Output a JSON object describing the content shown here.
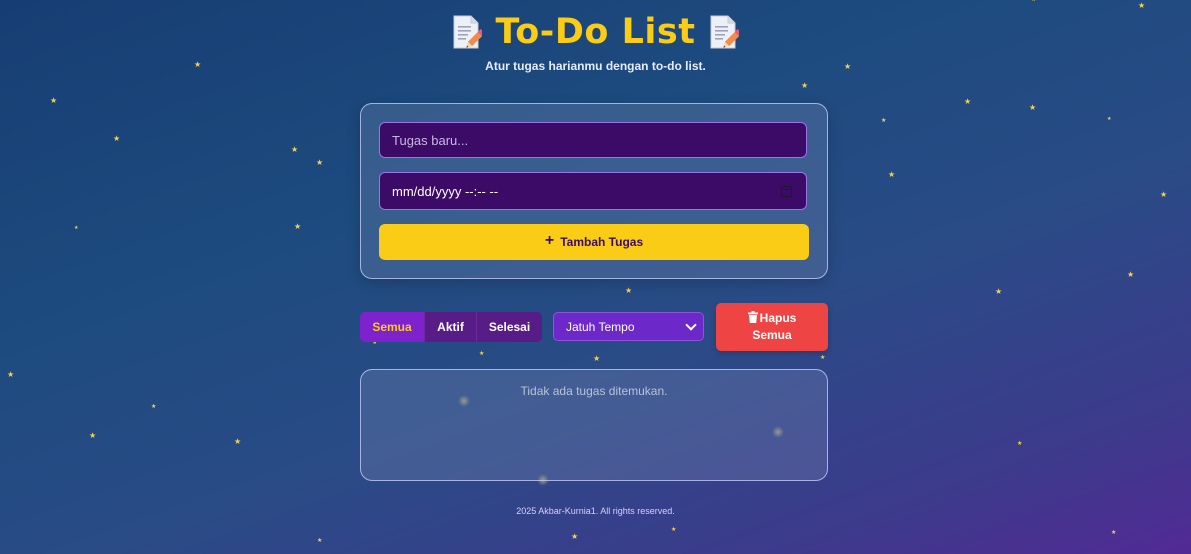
{
  "header": {
    "title": "To-Do List",
    "subtitle": "Atur tugas harianmu dengan to-do list.",
    "title_icons": [
      "memo-icon",
      "memo-icon"
    ]
  },
  "form": {
    "task_placeholder": "Tugas baru...",
    "task_value": "",
    "date_placeholder": "mm/dd/yyyy --:-- --",
    "date_value": "",
    "add_button_label": "Tambah Tugas",
    "add_button_icon": "plus-icon"
  },
  "filters": {
    "items": [
      {
        "label": "Semua",
        "active": true
      },
      {
        "label": "Aktif",
        "active": false
      },
      {
        "label": "Selesai",
        "active": false
      }
    ]
  },
  "sort": {
    "selected": "Jatuh Tempo"
  },
  "actions": {
    "delete_all_line1": "Hapus",
    "delete_all_line2": "Semua",
    "delete_all_icon": "trash-icon"
  },
  "list": {
    "empty_text": "Tidak ada tugas ditemukan."
  },
  "footer": {
    "text": "2025 Akbar-Kurnia1. All rights reserved."
  },
  "colors": {
    "accent_yellow": "#facc15",
    "input_bg": "#3b0b67",
    "filter_bg": "#581c87",
    "filter_active_bg": "#7e22ce",
    "danger": "#ef4444"
  }
}
